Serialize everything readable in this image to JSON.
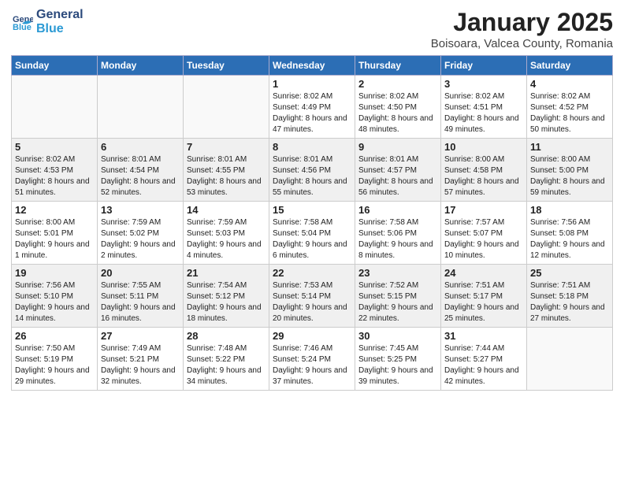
{
  "logo": {
    "line1": "General",
    "line2": "Blue"
  },
  "title": "January 2025",
  "location": "Boisoara, Valcea County, Romania",
  "days_of_week": [
    "Sunday",
    "Monday",
    "Tuesday",
    "Wednesday",
    "Thursday",
    "Friday",
    "Saturday"
  ],
  "weeks": [
    [
      {
        "day": "",
        "info": ""
      },
      {
        "day": "",
        "info": ""
      },
      {
        "day": "",
        "info": ""
      },
      {
        "day": "1",
        "info": "Sunrise: 8:02 AM\nSunset: 4:49 PM\nDaylight: 8 hours and 47 minutes."
      },
      {
        "day": "2",
        "info": "Sunrise: 8:02 AM\nSunset: 4:50 PM\nDaylight: 8 hours and 48 minutes."
      },
      {
        "day": "3",
        "info": "Sunrise: 8:02 AM\nSunset: 4:51 PM\nDaylight: 8 hours and 49 minutes."
      },
      {
        "day": "4",
        "info": "Sunrise: 8:02 AM\nSunset: 4:52 PM\nDaylight: 8 hours and 50 minutes."
      }
    ],
    [
      {
        "day": "5",
        "info": "Sunrise: 8:02 AM\nSunset: 4:53 PM\nDaylight: 8 hours and 51 minutes."
      },
      {
        "day": "6",
        "info": "Sunrise: 8:01 AM\nSunset: 4:54 PM\nDaylight: 8 hours and 52 minutes."
      },
      {
        "day": "7",
        "info": "Sunrise: 8:01 AM\nSunset: 4:55 PM\nDaylight: 8 hours and 53 minutes."
      },
      {
        "day": "8",
        "info": "Sunrise: 8:01 AM\nSunset: 4:56 PM\nDaylight: 8 hours and 55 minutes."
      },
      {
        "day": "9",
        "info": "Sunrise: 8:01 AM\nSunset: 4:57 PM\nDaylight: 8 hours and 56 minutes."
      },
      {
        "day": "10",
        "info": "Sunrise: 8:00 AM\nSunset: 4:58 PM\nDaylight: 8 hours and 57 minutes."
      },
      {
        "day": "11",
        "info": "Sunrise: 8:00 AM\nSunset: 5:00 PM\nDaylight: 8 hours and 59 minutes."
      }
    ],
    [
      {
        "day": "12",
        "info": "Sunrise: 8:00 AM\nSunset: 5:01 PM\nDaylight: 9 hours and 1 minute."
      },
      {
        "day": "13",
        "info": "Sunrise: 7:59 AM\nSunset: 5:02 PM\nDaylight: 9 hours and 2 minutes."
      },
      {
        "day": "14",
        "info": "Sunrise: 7:59 AM\nSunset: 5:03 PM\nDaylight: 9 hours and 4 minutes."
      },
      {
        "day": "15",
        "info": "Sunrise: 7:58 AM\nSunset: 5:04 PM\nDaylight: 9 hours and 6 minutes."
      },
      {
        "day": "16",
        "info": "Sunrise: 7:58 AM\nSunset: 5:06 PM\nDaylight: 9 hours and 8 minutes."
      },
      {
        "day": "17",
        "info": "Sunrise: 7:57 AM\nSunset: 5:07 PM\nDaylight: 9 hours and 10 minutes."
      },
      {
        "day": "18",
        "info": "Sunrise: 7:56 AM\nSunset: 5:08 PM\nDaylight: 9 hours and 12 minutes."
      }
    ],
    [
      {
        "day": "19",
        "info": "Sunrise: 7:56 AM\nSunset: 5:10 PM\nDaylight: 9 hours and 14 minutes."
      },
      {
        "day": "20",
        "info": "Sunrise: 7:55 AM\nSunset: 5:11 PM\nDaylight: 9 hours and 16 minutes."
      },
      {
        "day": "21",
        "info": "Sunrise: 7:54 AM\nSunset: 5:12 PM\nDaylight: 9 hours and 18 minutes."
      },
      {
        "day": "22",
        "info": "Sunrise: 7:53 AM\nSunset: 5:14 PM\nDaylight: 9 hours and 20 minutes."
      },
      {
        "day": "23",
        "info": "Sunrise: 7:52 AM\nSunset: 5:15 PM\nDaylight: 9 hours and 22 minutes."
      },
      {
        "day": "24",
        "info": "Sunrise: 7:51 AM\nSunset: 5:17 PM\nDaylight: 9 hours and 25 minutes."
      },
      {
        "day": "25",
        "info": "Sunrise: 7:51 AM\nSunset: 5:18 PM\nDaylight: 9 hours and 27 minutes."
      }
    ],
    [
      {
        "day": "26",
        "info": "Sunrise: 7:50 AM\nSunset: 5:19 PM\nDaylight: 9 hours and 29 minutes."
      },
      {
        "day": "27",
        "info": "Sunrise: 7:49 AM\nSunset: 5:21 PM\nDaylight: 9 hours and 32 minutes."
      },
      {
        "day": "28",
        "info": "Sunrise: 7:48 AM\nSunset: 5:22 PM\nDaylight: 9 hours and 34 minutes."
      },
      {
        "day": "29",
        "info": "Sunrise: 7:46 AM\nSunset: 5:24 PM\nDaylight: 9 hours and 37 minutes."
      },
      {
        "day": "30",
        "info": "Sunrise: 7:45 AM\nSunset: 5:25 PM\nDaylight: 9 hours and 39 minutes."
      },
      {
        "day": "31",
        "info": "Sunrise: 7:44 AM\nSunset: 5:27 PM\nDaylight: 9 hours and 42 minutes."
      },
      {
        "day": "",
        "info": ""
      }
    ]
  ]
}
